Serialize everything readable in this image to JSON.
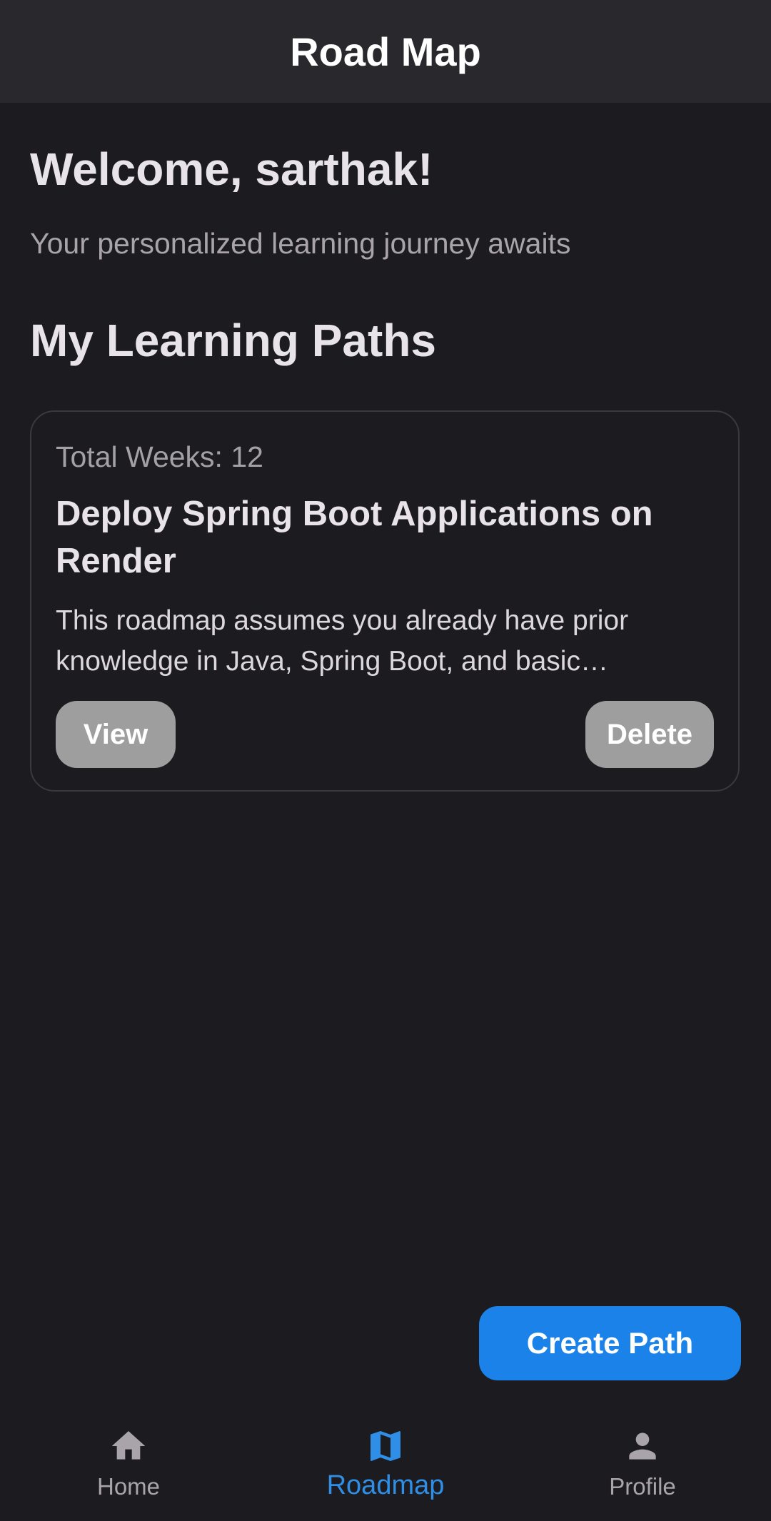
{
  "appbar": {
    "title": "Road Map"
  },
  "welcome": {
    "heading": "Welcome, sarthak!",
    "subtitle": "Your personalized learning journey awaits"
  },
  "section": {
    "title": "My Learning Paths"
  },
  "paths": [
    {
      "weeks_label": "Total Weeks: 12",
      "title": "Deploy Spring Boot Applications on Render",
      "description": "This roadmap assumes you already have prior knowledge in Java, Spring Boot, and basic Git/GitHub usage.",
      "view_label": "View",
      "delete_label": "Delete"
    }
  ],
  "fab": {
    "label": "Create Path"
  },
  "bottom_nav": {
    "items": [
      {
        "label": "Home",
        "icon": "home-icon",
        "active": false
      },
      {
        "label": "Roadmap",
        "icon": "map-icon",
        "active": true
      },
      {
        "label": "Profile",
        "icon": "person-icon",
        "active": false
      }
    ]
  },
  "colors": {
    "background": "#1c1b20",
    "appbar": "#29292d",
    "accent": "#1a82e8",
    "active_nav": "#2f8ee5",
    "pill_button": "#9e9e9e"
  }
}
